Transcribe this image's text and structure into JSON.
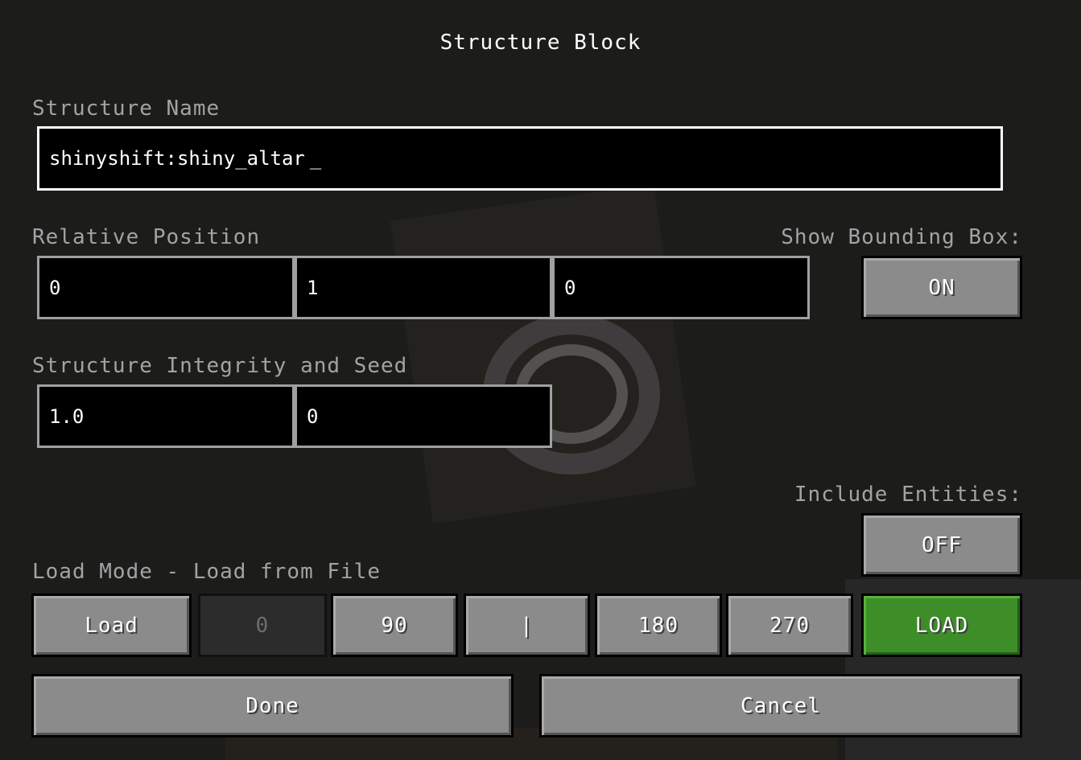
{
  "title": "Structure Block",
  "structure_name": {
    "label": "Structure Name",
    "value": "shinyshift:shiny_altar",
    "caret": "_"
  },
  "relative_position": {
    "label": "Relative Position",
    "x": "0",
    "y": "1",
    "z": "0"
  },
  "bounding_box": {
    "label": "Show Bounding Box:",
    "toggle": "ON"
  },
  "integrity_seed": {
    "label": "Structure Integrity and Seed",
    "integrity": "1.0",
    "seed": "0"
  },
  "include_entities": {
    "label": "Include Entities:",
    "toggle": "OFF"
  },
  "load_mode": {
    "label": "Load Mode - Load from File",
    "mode_button": "Load",
    "rotation_buttons": [
      "0",
      "90",
      "|",
      "180",
      "270"
    ],
    "action_button": "LOAD",
    "action_color": "#3d8e28"
  },
  "footer": {
    "done": "Done",
    "cancel": "Cancel"
  }
}
